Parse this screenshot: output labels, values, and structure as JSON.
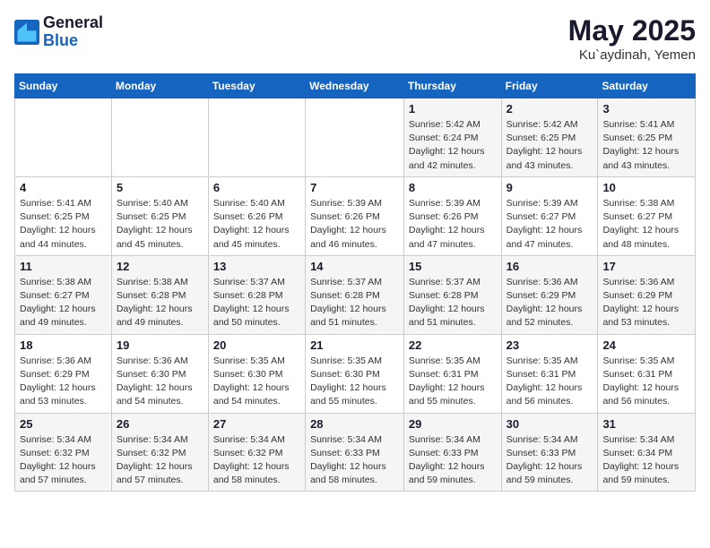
{
  "logo": {
    "line1": "General",
    "line2": "Blue"
  },
  "title": "May 2025",
  "location": "Ku`aydinah, Yemen",
  "days_of_week": [
    "Sunday",
    "Monday",
    "Tuesday",
    "Wednesday",
    "Thursday",
    "Friday",
    "Saturday"
  ],
  "weeks": [
    [
      {
        "day": "",
        "info": ""
      },
      {
        "day": "",
        "info": ""
      },
      {
        "day": "",
        "info": ""
      },
      {
        "day": "",
        "info": ""
      },
      {
        "day": "1",
        "info": "Sunrise: 5:42 AM\nSunset: 6:24 PM\nDaylight: 12 hours\nand 42 minutes."
      },
      {
        "day": "2",
        "info": "Sunrise: 5:42 AM\nSunset: 6:25 PM\nDaylight: 12 hours\nand 43 minutes."
      },
      {
        "day": "3",
        "info": "Sunrise: 5:41 AM\nSunset: 6:25 PM\nDaylight: 12 hours\nand 43 minutes."
      }
    ],
    [
      {
        "day": "4",
        "info": "Sunrise: 5:41 AM\nSunset: 6:25 PM\nDaylight: 12 hours\nand 44 minutes."
      },
      {
        "day": "5",
        "info": "Sunrise: 5:40 AM\nSunset: 6:25 PM\nDaylight: 12 hours\nand 45 minutes."
      },
      {
        "day": "6",
        "info": "Sunrise: 5:40 AM\nSunset: 6:26 PM\nDaylight: 12 hours\nand 45 minutes."
      },
      {
        "day": "7",
        "info": "Sunrise: 5:39 AM\nSunset: 6:26 PM\nDaylight: 12 hours\nand 46 minutes."
      },
      {
        "day": "8",
        "info": "Sunrise: 5:39 AM\nSunset: 6:26 PM\nDaylight: 12 hours\nand 47 minutes."
      },
      {
        "day": "9",
        "info": "Sunrise: 5:39 AM\nSunset: 6:27 PM\nDaylight: 12 hours\nand 47 minutes."
      },
      {
        "day": "10",
        "info": "Sunrise: 5:38 AM\nSunset: 6:27 PM\nDaylight: 12 hours\nand 48 minutes."
      }
    ],
    [
      {
        "day": "11",
        "info": "Sunrise: 5:38 AM\nSunset: 6:27 PM\nDaylight: 12 hours\nand 49 minutes."
      },
      {
        "day": "12",
        "info": "Sunrise: 5:38 AM\nSunset: 6:28 PM\nDaylight: 12 hours\nand 49 minutes."
      },
      {
        "day": "13",
        "info": "Sunrise: 5:37 AM\nSunset: 6:28 PM\nDaylight: 12 hours\nand 50 minutes."
      },
      {
        "day": "14",
        "info": "Sunrise: 5:37 AM\nSunset: 6:28 PM\nDaylight: 12 hours\nand 51 minutes."
      },
      {
        "day": "15",
        "info": "Sunrise: 5:37 AM\nSunset: 6:28 PM\nDaylight: 12 hours\nand 51 minutes."
      },
      {
        "day": "16",
        "info": "Sunrise: 5:36 AM\nSunset: 6:29 PM\nDaylight: 12 hours\nand 52 minutes."
      },
      {
        "day": "17",
        "info": "Sunrise: 5:36 AM\nSunset: 6:29 PM\nDaylight: 12 hours\nand 53 minutes."
      }
    ],
    [
      {
        "day": "18",
        "info": "Sunrise: 5:36 AM\nSunset: 6:29 PM\nDaylight: 12 hours\nand 53 minutes."
      },
      {
        "day": "19",
        "info": "Sunrise: 5:36 AM\nSunset: 6:30 PM\nDaylight: 12 hours\nand 54 minutes."
      },
      {
        "day": "20",
        "info": "Sunrise: 5:35 AM\nSunset: 6:30 PM\nDaylight: 12 hours\nand 54 minutes."
      },
      {
        "day": "21",
        "info": "Sunrise: 5:35 AM\nSunset: 6:30 PM\nDaylight: 12 hours\nand 55 minutes."
      },
      {
        "day": "22",
        "info": "Sunrise: 5:35 AM\nSunset: 6:31 PM\nDaylight: 12 hours\nand 55 minutes."
      },
      {
        "day": "23",
        "info": "Sunrise: 5:35 AM\nSunset: 6:31 PM\nDaylight: 12 hours\nand 56 minutes."
      },
      {
        "day": "24",
        "info": "Sunrise: 5:35 AM\nSunset: 6:31 PM\nDaylight: 12 hours\nand 56 minutes."
      }
    ],
    [
      {
        "day": "25",
        "info": "Sunrise: 5:34 AM\nSunset: 6:32 PM\nDaylight: 12 hours\nand 57 minutes."
      },
      {
        "day": "26",
        "info": "Sunrise: 5:34 AM\nSunset: 6:32 PM\nDaylight: 12 hours\nand 57 minutes."
      },
      {
        "day": "27",
        "info": "Sunrise: 5:34 AM\nSunset: 6:32 PM\nDaylight: 12 hours\nand 58 minutes."
      },
      {
        "day": "28",
        "info": "Sunrise: 5:34 AM\nSunset: 6:33 PM\nDaylight: 12 hours\nand 58 minutes."
      },
      {
        "day": "29",
        "info": "Sunrise: 5:34 AM\nSunset: 6:33 PM\nDaylight: 12 hours\nand 59 minutes."
      },
      {
        "day": "30",
        "info": "Sunrise: 5:34 AM\nSunset: 6:33 PM\nDaylight: 12 hours\nand 59 minutes."
      },
      {
        "day": "31",
        "info": "Sunrise: 5:34 AM\nSunset: 6:34 PM\nDaylight: 12 hours\nand 59 minutes."
      }
    ]
  ]
}
